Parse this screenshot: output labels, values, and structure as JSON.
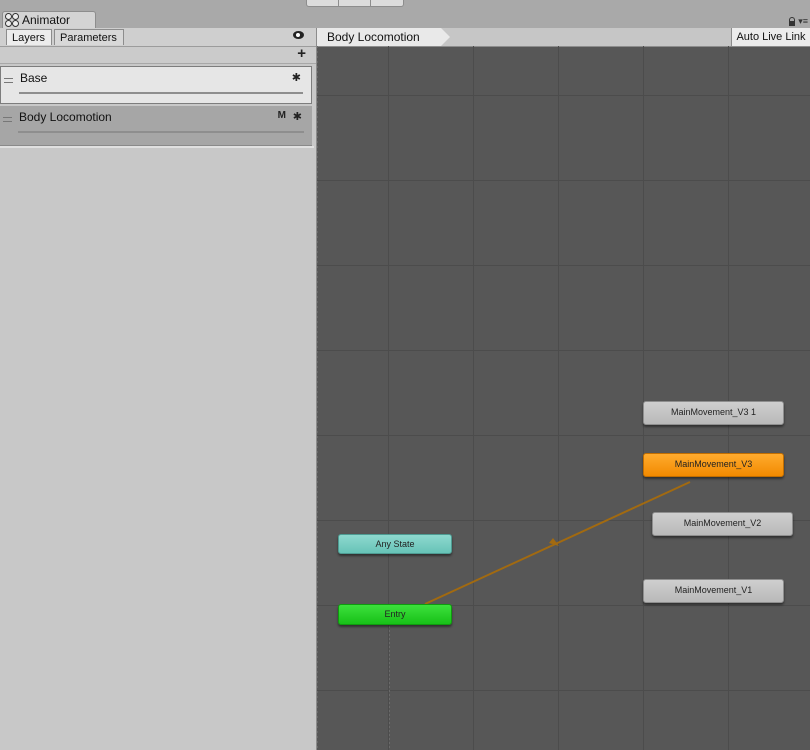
{
  "window": {
    "tab_title": "Animator"
  },
  "left_panel": {
    "tabs": [
      {
        "label": "Layers",
        "active": true
      },
      {
        "label": "Parameters",
        "active": false
      }
    ],
    "layers": [
      {
        "name": "Base",
        "selected": false
      },
      {
        "name": "Body Locomotion",
        "selected": true,
        "badge": "M"
      }
    ]
  },
  "graph": {
    "breadcrumb": "Body Locomotion",
    "auto_live_link": "Auto Live Link",
    "states": {
      "any_state": "Any State",
      "entry": "Entry",
      "v3_1": "MainMovement_V3 1",
      "v3": "MainMovement_V3",
      "v2": "MainMovement_V2",
      "v1": "MainMovement_V1"
    }
  },
  "colors": {
    "graph_bg": "#575757",
    "default_state": "#f28a00",
    "entry": "#18c018",
    "any_state": "#67c3b7",
    "transition": "#a26a10"
  }
}
